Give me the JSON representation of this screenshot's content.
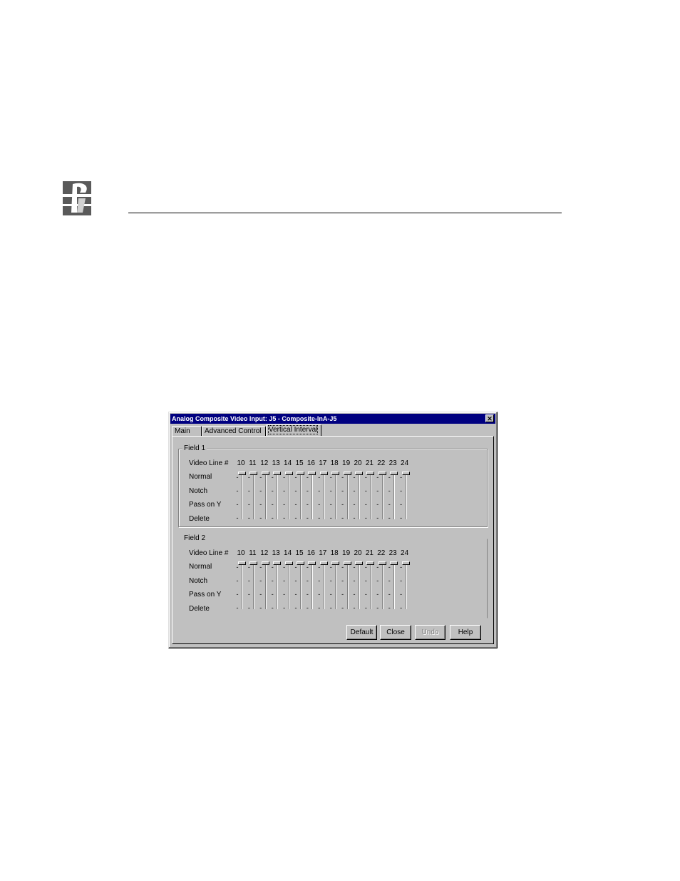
{
  "dialog": {
    "title": "Analog Composite Video Input: J5 - Composite-InA-J5",
    "close_glyph": "✕",
    "tabs": [
      {
        "label": "Main",
        "active": false
      },
      {
        "label": "Advanced Control",
        "active": false
      },
      {
        "label": "Vertical Interval",
        "active": true
      }
    ],
    "field1": {
      "legend": "Field 1",
      "header_label": "Video Line #",
      "rows": [
        "Normal",
        "Notch",
        "Pass on Y",
        "Delete"
      ],
      "lines": [
        "10",
        "11",
        "12",
        "13",
        "14",
        "15",
        "16",
        "17",
        "18",
        "19",
        "20",
        "21",
        "22",
        "23",
        "24"
      ],
      "selected_setting": "Normal"
    },
    "field2": {
      "legend": "Field 2",
      "header_label": "Video Line #",
      "rows": [
        "Normal",
        "Notch",
        "Pass on Y",
        "Delete"
      ],
      "lines": [
        "10",
        "11",
        "12",
        "13",
        "14",
        "15",
        "16",
        "17",
        "18",
        "19",
        "20",
        "21",
        "22",
        "23",
        "24"
      ],
      "selected_setting": "Normal"
    },
    "buttons": {
      "default": "Default",
      "close": "Close",
      "undo": "Undo",
      "help": "Help"
    }
  },
  "colors": {
    "dialog_face": "#c0c0c0",
    "title_bar": "#000080"
  },
  "icons": {
    "brand_logo": "logo-icon",
    "close": "close-icon"
  }
}
